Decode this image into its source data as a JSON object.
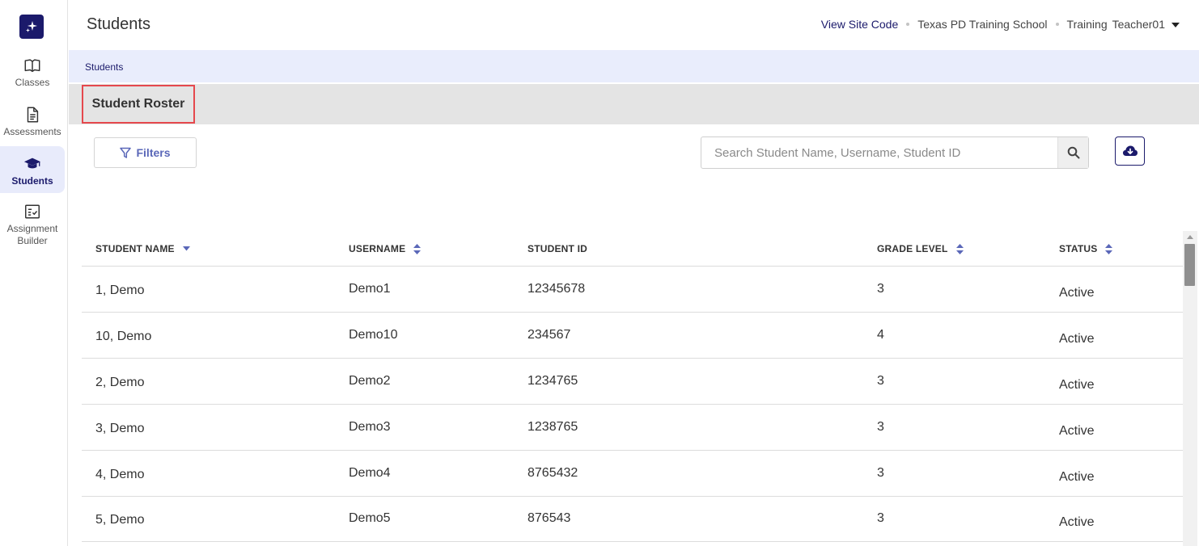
{
  "sidebar": {
    "logo_icon": "sparkle-icon",
    "items": [
      {
        "label": "Classes",
        "icon": "book-open-icon"
      },
      {
        "label": "Assessments",
        "icon": "document-icon"
      },
      {
        "label": "Students",
        "icon": "graduation-cap-icon",
        "active": true
      },
      {
        "label": "Assignment Builder",
        "icon": "checklist-icon"
      }
    ]
  },
  "header": {
    "title": "Students",
    "site_code_link": "View Site Code",
    "school": "Texas PD Training School",
    "user_first": "Training",
    "user_last": "Teacher01"
  },
  "breadcrumb": "Students",
  "section": {
    "title": "Student Roster"
  },
  "toolbar": {
    "filters_label": "Filters",
    "search_placeholder": "Search Student Name, Username, Student ID",
    "search_value": ""
  },
  "table": {
    "columns": [
      "STUDENT NAME",
      "USERNAME",
      "STUDENT ID",
      "GRADE LEVEL",
      "STATUS"
    ],
    "rows": [
      {
        "name": "1, Demo",
        "username": "Demo1",
        "student_id": "12345678",
        "grade": "3",
        "status": "Active"
      },
      {
        "name": "10, Demo",
        "username": "Demo10",
        "student_id": "234567",
        "grade": "4",
        "status": "Active"
      },
      {
        "name": "2, Demo",
        "username": "Demo2",
        "student_id": "1234765",
        "grade": "3",
        "status": "Active"
      },
      {
        "name": "3, Demo",
        "username": "Demo3",
        "student_id": "1238765",
        "grade": "3",
        "status": "Active"
      },
      {
        "name": "4, Demo",
        "username": "Demo4",
        "student_id": "8765432",
        "grade": "3",
        "status": "Active"
      },
      {
        "name": "5, Demo",
        "username": "Demo5",
        "student_id": "876543",
        "grade": "3",
        "status": "Active"
      }
    ]
  },
  "colors": {
    "brand": "#1b1a6b",
    "accent": "#5a67b8",
    "highlight_border": "#e5484d"
  }
}
